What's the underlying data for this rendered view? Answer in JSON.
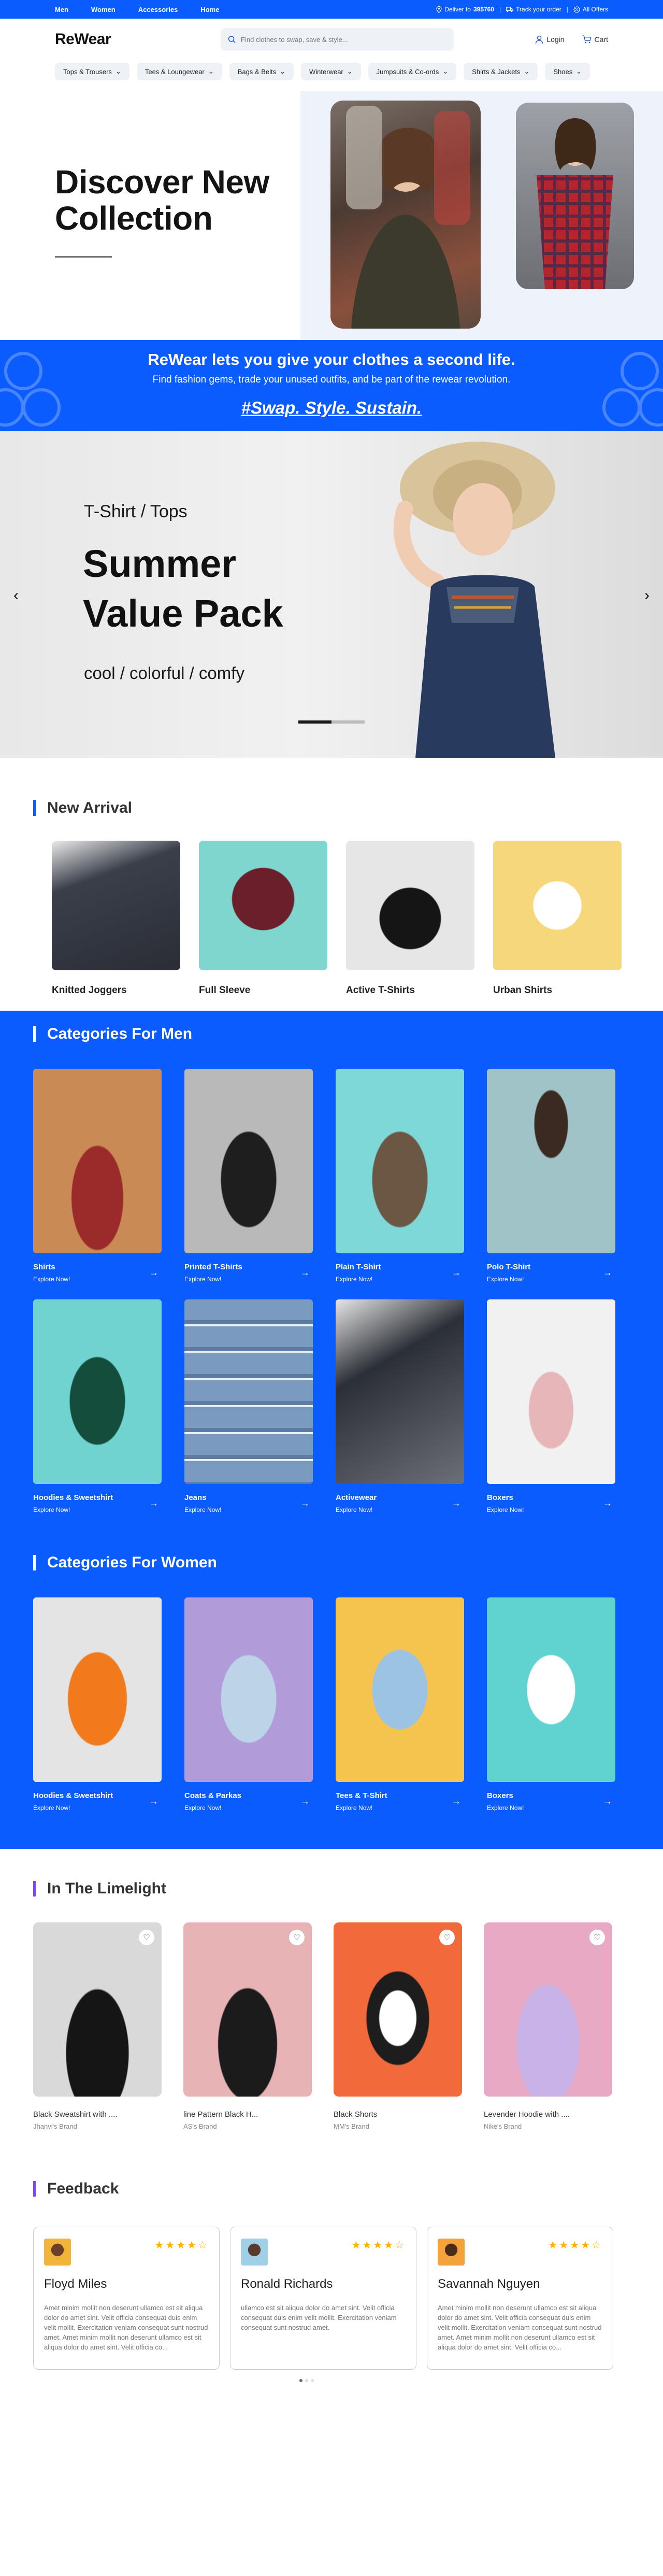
{
  "topbar": {
    "nav": [
      "Men",
      "Women",
      "Accessories",
      "Home"
    ],
    "deliver_prefix": "Deliver to",
    "pincode": "395760",
    "track": "Track your order",
    "offers": "All Offers"
  },
  "header": {
    "logo": "ReWear",
    "search_placeholder": "Find clothes to swap, save & style...",
    "login": "Login",
    "cart": "Cart"
  },
  "categories_bar": [
    "Tops & Trousers",
    "Tees & Loungewear",
    "Bags & Belts",
    "Winterwear",
    "Jumpsuits & Co-ords",
    "Shirts & Jackets",
    "Shoes"
  ],
  "hero": {
    "title_line1": "Discover New",
    "title_line2": "Collection"
  },
  "banner": {
    "line1": "ReWear lets you give your clothes a second life.",
    "line2": "Find fashion gems, trade your unused outfits, and be part of the rewear revolution.",
    "hashtag": "#Swap. Style. Sustain."
  },
  "carousel": {
    "kicker": "T-Shirt / Tops",
    "title_line1": "Summer",
    "title_line2": "Value Pack",
    "subtitle": "cool / colorful / comfy"
  },
  "new_arrival": {
    "title": "New Arrival",
    "items": [
      {
        "label": "Knitted Joggers",
        "color": "#3a3f4a"
      },
      {
        "label": "Full Sleeve",
        "color": "#7fd6cf"
      },
      {
        "label": "Active T-Shirts",
        "color": "#e6e6e6"
      },
      {
        "label": "Urban Shirts",
        "color": "#f6d77b"
      }
    ]
  },
  "men": {
    "title": "Categories For Men",
    "items": [
      {
        "name": "Shirts",
        "cta": "Explore Now!",
        "color": "#c98a55"
      },
      {
        "name": "Printed T-Shirts",
        "cta": "Explore Now!",
        "color": "#b9b9b9"
      },
      {
        "name": "Plain T-Shirt",
        "cta": "Explore Now!",
        "color": "#7fd8d8"
      },
      {
        "name": "Polo T-Shirt",
        "cta": "Explore Now!",
        "color": "#9fc3c7"
      },
      {
        "name": "Hoodies & Sweetshirt",
        "cta": "Explore Now!",
        "color": "#6fd3cf"
      },
      {
        "name": "Jeans",
        "cta": "Explore Now!",
        "color": "#e9eef3"
      },
      {
        "name": "Activewear",
        "cta": "Explore Now!",
        "color": "#6d6f77"
      },
      {
        "name": "Boxers",
        "cta": "Explore Now!",
        "color": "#f1f1f1"
      }
    ]
  },
  "women": {
    "title": "Categories For Women",
    "items": [
      {
        "name": "Hoodies & Sweetshirt",
        "cta": "Explore Now!",
        "color": "#e4e4e4"
      },
      {
        "name": "Coats & Parkas",
        "cta": "Explore Now!",
        "color": "#b19bd8"
      },
      {
        "name": "Tees & T-Shirt",
        "cta": "Explore Now!",
        "color": "#f5c44f"
      },
      {
        "name": "Boxers",
        "cta": "Explore Now!",
        "color": "#60d2cf"
      }
    ]
  },
  "limelight": {
    "title": "In The Limelight",
    "items": [
      {
        "name": "Black Sweatshirt with ....",
        "brand": "Jhanvi's  Brand",
        "color": "#d9d9d9"
      },
      {
        "name": "line Pattern Black H...",
        "brand": "AS's  Brand",
        "color": "#e7b3b5"
      },
      {
        "name": "Black Shorts",
        "brand": "MM's  Brand",
        "color": "#f26a3b"
      },
      {
        "name": "Levender Hoodie with ....",
        "brand": "Nike's  Brand",
        "color": "#e7a9c4"
      }
    ]
  },
  "feedback": {
    "title": "Feedback",
    "items": [
      {
        "name": "Floyd Miles",
        "stars": "★★★★☆",
        "avatar_color": "#f2b53b",
        "text": "Amet minim mollit non deserunt ullamco est sit aliqua dolor do amet sint. Velit officia consequat duis enim velit mollit. Exercitation veniam consequat sunt nostrud amet. Amet minim mollit non deserunt ullamco est sit aliqua dolor do amet sint. Velit officia co..."
      },
      {
        "name": "Ronald Richards",
        "stars": "★★★★☆",
        "avatar_color": "#9fd0e8",
        "text": "ullamco est sit aliqua dolor do amet sint. Velit officia consequat duis enim velit mollit. Exercitation veniam consequat sunt nostrud amet."
      },
      {
        "name": "Savannah Nguyen",
        "stars": "★★★★☆",
        "avatar_color": "#f4a33a",
        "text": "Amet minim mollit non deserunt ullamco est sit aliqua dolor do amet sint. Velit officia consequat duis enim velit mollit. Exercitation veniam consequat sunt nostrud amet. Amet minim mollit non deserunt ullamco est sit aliqua dolor do amet sint. Velit officia co..."
      }
    ]
  },
  "colors": {
    "brand_blue": "#0b5cff",
    "star": "#f6b400"
  }
}
